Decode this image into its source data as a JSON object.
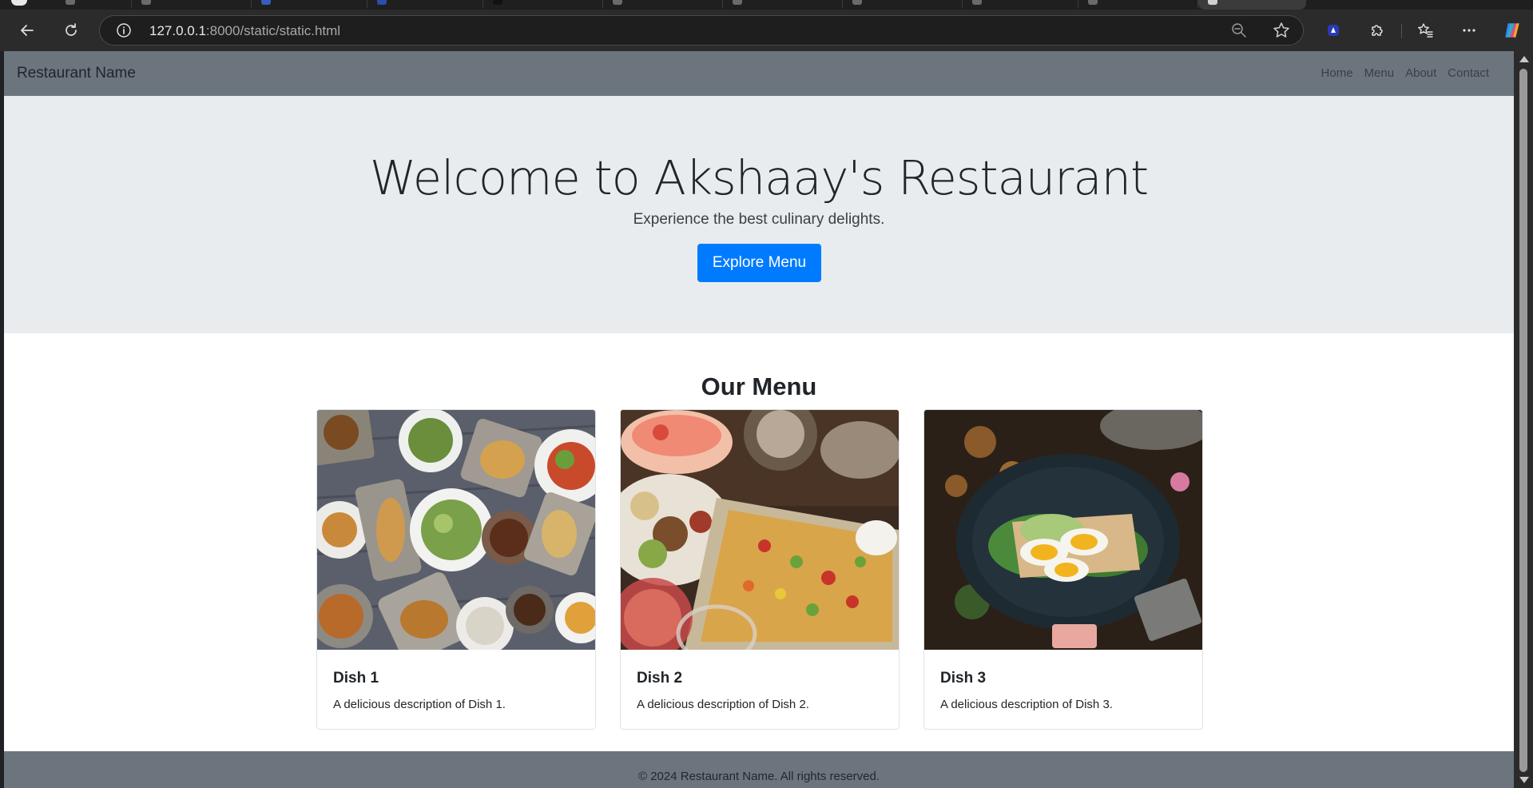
{
  "browser": {
    "url_host": "127.0.0.1",
    "url_path": ":8000/static/static.html"
  },
  "nav": {
    "brand": "Restaurant Name",
    "links": [
      "Home",
      "Menu",
      "About",
      "Contact"
    ]
  },
  "hero": {
    "title": "Welcome to Akshaay's Restaurant",
    "lead": "Experience the best culinary delights.",
    "button": "Explore Menu"
  },
  "menu": {
    "title": "Our Menu",
    "dishes": [
      {
        "name": "Dish 1",
        "description": "A delicious description of Dish 1."
      },
      {
        "name": "Dish 2",
        "description": "A delicious description of Dish 2."
      },
      {
        "name": "Dish 3",
        "description": "A delicious description of Dish 3."
      }
    ]
  },
  "footer": {
    "text": "© 2024 Restaurant Name. All rights reserved."
  },
  "colors": {
    "navbar": "#6c757d",
    "hero_bg": "#e9ecef",
    "primary": "#007bff"
  }
}
